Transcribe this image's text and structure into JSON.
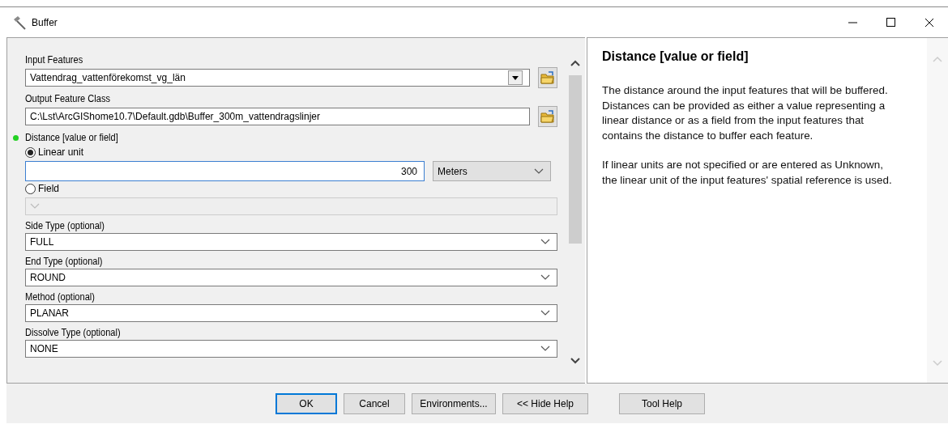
{
  "window": {
    "title": "Buffer"
  },
  "parameters": [
    {
      "kind": "combo",
      "label": "Input Features",
      "value": "Vattendrag_vattenförekomst_vg_län",
      "browse": true
    },
    {
      "kind": "text",
      "label": "Output Feature Class",
      "value": "C:\\Lst\\ArcGIShome10.7\\Default.gdb\\Buffer_300m_vattendragslinjer",
      "browse": true
    },
    {
      "kind": "distance",
      "label": "Distance [value or field]",
      "required": true,
      "options": [
        {
          "label": "Linear unit",
          "selected": true,
          "value": "300",
          "unit": "Meters"
        },
        {
          "label": "Field",
          "selected": false
        }
      ]
    },
    {
      "kind": "select",
      "label": "Side Type (optional)",
      "value": "FULL"
    },
    {
      "kind": "select",
      "label": "End Type (optional)",
      "value": "ROUND"
    },
    {
      "kind": "select",
      "label": "Method (optional)",
      "value": "PLANAR"
    },
    {
      "kind": "select",
      "label": "Dissolve Type (optional)",
      "value": "NONE"
    }
  ],
  "help": {
    "title": "Distance [value or field]",
    "paragraphs": [
      "The distance around the input features that will be buffered. Distances can be provided as either a value representing a linear distance or as a field from the input features that contains the distance to buffer each feature.",
      "If linear units are not specified or are entered as Unknown, the linear unit of the input features' spatial reference is used."
    ]
  },
  "buttons": [
    {
      "label": "OK",
      "default": true
    },
    {
      "label": "Cancel",
      "default": false
    },
    {
      "label": "Environments...",
      "default": false
    },
    {
      "label": "<< Hide Help",
      "default": false
    },
    {
      "label": "Tool Help",
      "default": false
    }
  ]
}
